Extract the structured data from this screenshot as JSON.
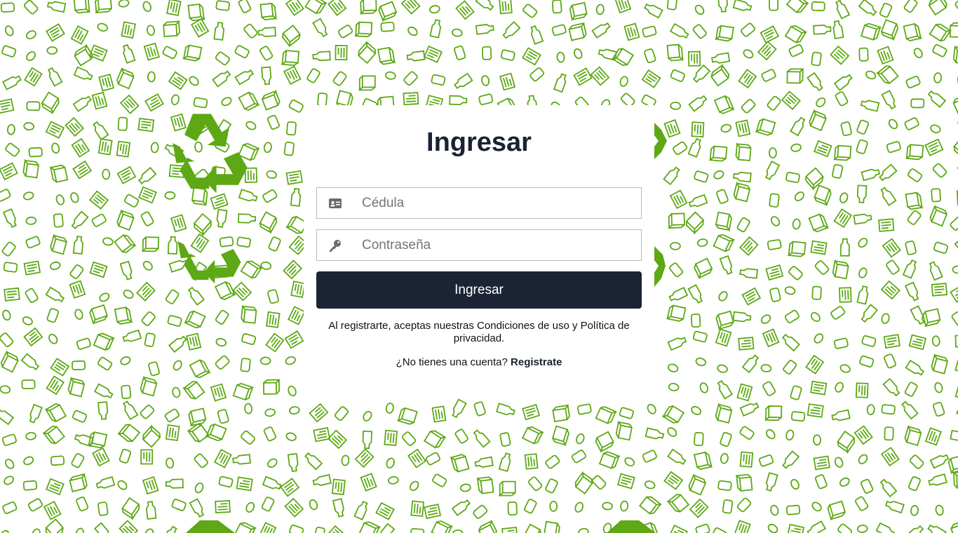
{
  "colors": {
    "pattern_green": "#5da814",
    "button_bg": "#1b2334",
    "title_color": "#1a2233"
  },
  "login": {
    "title": "Ingresar",
    "cedula_placeholder": "Cédula",
    "password_placeholder": "Contraseña",
    "submit_label": "Ingresar",
    "terms_text": "Al registrarte, aceptas nuestras Condiciones de uso y Política de privacidad.",
    "no_account_text": "¿No tienes una cuenta?",
    "register_link": "Registrate"
  },
  "icons": {
    "cedula_icon": "id-card-icon",
    "password_icon": "key-icon",
    "background_icon": "recycle-icon"
  }
}
